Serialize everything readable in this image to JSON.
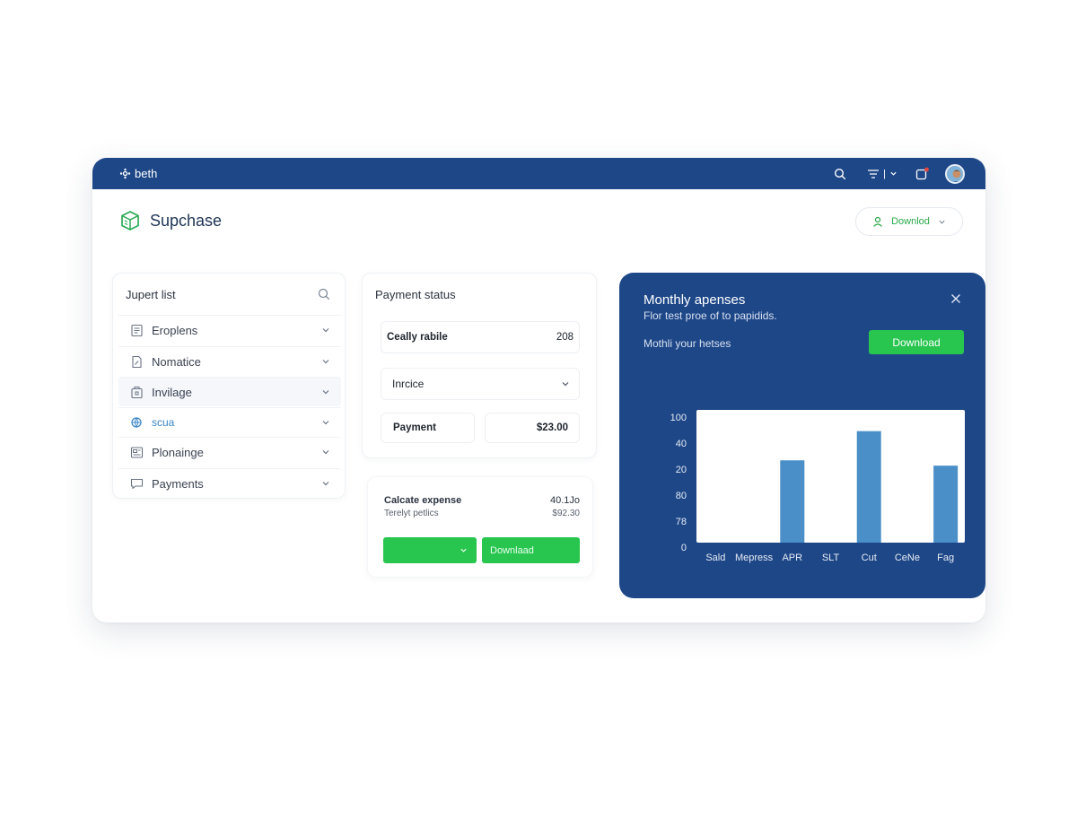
{
  "topbar": {
    "brand": "beth",
    "filter_label": "|",
    "notification_badge": ""
  },
  "app": {
    "title": "Supchase",
    "top_button_label": "Downlod"
  },
  "list_panel": {
    "title": "Jupert list",
    "items": [
      {
        "label": "Eroplens",
        "icon": "document-icon"
      },
      {
        "label": "Nomatice",
        "icon": "file-edit-icon"
      },
      {
        "label": "Invilage",
        "icon": "briefcase-icon"
      },
      {
        "label": "scua",
        "icon": "globe-icon"
      },
      {
        "label": "Plonainge",
        "icon": "newspaper-icon"
      },
      {
        "label": "Payments",
        "icon": "chat-icon"
      }
    ]
  },
  "payment": {
    "title": "Payment status",
    "ready_label": "Ceally rabile",
    "ready_value": "208",
    "invoice_label": "Inrcice",
    "payment_label": "Payment",
    "payment_value": "$23.00"
  },
  "expense": {
    "label1": "Calcate expense",
    "value1": "40.1Jo",
    "label2": "Terelyt petlics",
    "value2": "$92.30",
    "btn_right_label": "Downlaad"
  },
  "chart_panel": {
    "title": "Monthly apenses",
    "subtitle": "Flor test proe of to papidids.",
    "label": "Mothli your hetses",
    "download_label": "Download"
  },
  "colors": {
    "primary": "#1e4788",
    "accent_green": "#28c54f",
    "bar": "#4a8fc7"
  },
  "chart_data": {
    "type": "bar",
    "categories": [
      "Sald",
      "Mepress",
      "APR",
      "SLT",
      "Cut",
      "CeNe",
      "Fag"
    ],
    "values": [
      0,
      0,
      62,
      0,
      84,
      0,
      58
    ],
    "yticks": [
      "100",
      "40",
      "20",
      "80",
      "78",
      "0"
    ],
    "ylim": [
      0,
      100
    ],
    "title": "",
    "xlabel": "",
    "ylabel": ""
  }
}
